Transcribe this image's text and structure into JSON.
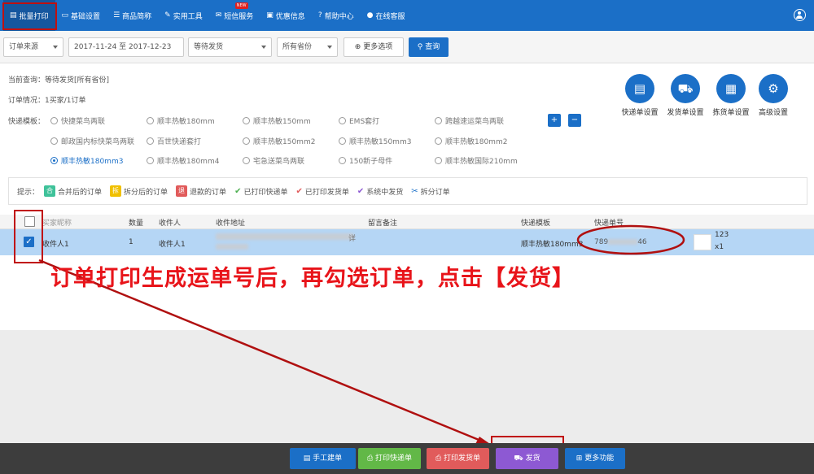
{
  "nav": {
    "items": [
      {
        "label": "批量打印",
        "icon": "print-icon"
      },
      {
        "label": "基础设置",
        "icon": "monitor-icon"
      },
      {
        "label": "商品简称",
        "icon": "list-icon"
      },
      {
        "label": "实用工具",
        "icon": "wrench-icon"
      },
      {
        "label": "短信服务",
        "icon": "mail-icon"
      },
      {
        "label": "优惠信息",
        "icon": "tag-icon"
      },
      {
        "label": "帮助中心",
        "icon": "help-icon"
      },
      {
        "label": "在线客服",
        "icon": "chat-icon"
      }
    ],
    "new_badge": "NEW"
  },
  "filters": {
    "source": "订单来源",
    "date_range": "2017-11-24 至 2017-12-23",
    "status": "等待发货",
    "province": "所有省份",
    "more_label": "更多选项",
    "query_label": "查询"
  },
  "info": {
    "current_query": "当前查询：等待发货[所有省份]",
    "order_status": "订单情况：1买家/1订单",
    "template_label": "快递模板："
  },
  "templates": [
    "快捷菜鸟两联",
    "顺丰热敏180mm",
    "顺丰热敏150mm",
    "EMS套打",
    "跨越速运菜鸟两联",
    "邮政国内标快菜鸟两联",
    "百世快递套打",
    "顺丰热敏150mm2",
    "顺丰热敏150mm3",
    "顺丰热敏180mm2",
    "顺丰热敏180mm3",
    "顺丰热敏180mm4",
    "宅急送菜鸟两联",
    "150新子母件",
    "顺丰热敏国际210mm"
  ],
  "quick_actions": [
    {
      "label": "快递单设置",
      "icon": "id-card-icon"
    },
    {
      "label": "发货单设置",
      "icon": "cart-icon"
    },
    {
      "label": "拣货单设置",
      "icon": "basket-icon"
    },
    {
      "label": "高级设置",
      "icon": "gear-icon"
    }
  ],
  "tips": {
    "label": "提示：",
    "items": [
      "合并后的订单",
      "拆分后的订单",
      "退款的订单",
      "已打印快递单",
      "已打印发货单",
      "系统中发货",
      "拆分订单"
    ],
    "badge_chars": [
      "合",
      "拆",
      "退"
    ]
  },
  "table": {
    "headers": [
      "买家昵称",
      "数量",
      "收件人",
      "收件地址",
      "留言备注",
      "快递模板",
      "快递单号"
    ],
    "row": {
      "buyer": "收件人1",
      "qty": "1",
      "recipient": "收件人1",
      "address_tail": "详",
      "template": "顺丰热敏180mm3",
      "tracking_prefix": "789",
      "tracking_suffix": "46",
      "extra_1": "123",
      "extra_2": "x1"
    }
  },
  "annotation": "订单打印生成运单号后，再勾选订单，点击【发货】",
  "bottom": {
    "buttons": [
      {
        "label": "手工建单",
        "color": "#1b6fc7"
      },
      {
        "label": "打印快递单",
        "color": "#62b847"
      },
      {
        "label": "打印发货单",
        "color": "#e15b5b"
      },
      {
        "label": "发货",
        "color": "#8d59d3"
      },
      {
        "label": "更多功能",
        "color": "#1b6fc7"
      }
    ]
  },
  "colors": {
    "primary": "#1b6fc7",
    "highlight_row": "#b5d6f5",
    "annotation_red": "#e8141a"
  }
}
